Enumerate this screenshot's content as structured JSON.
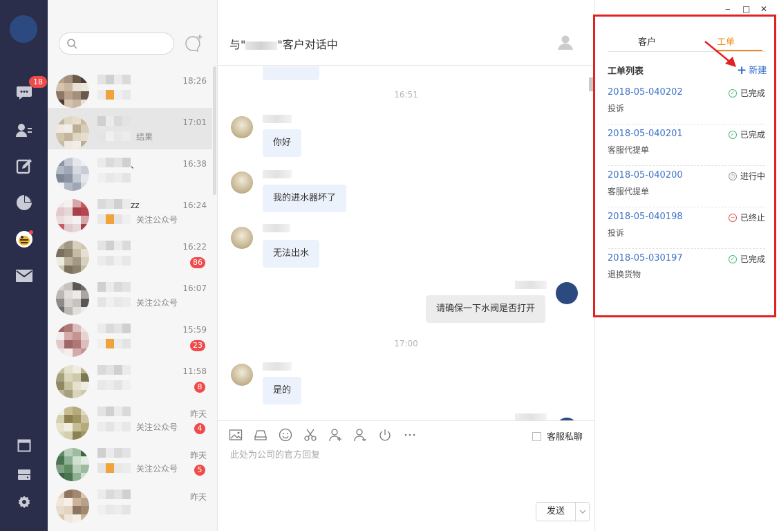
{
  "nav": {
    "chat_badge": "18"
  },
  "search": {
    "placeholder": ""
  },
  "conversations": [
    {
      "time": "18:26",
      "name_text": "",
      "preview_text": "",
      "count": ""
    },
    {
      "time": "17:01",
      "name_text": "",
      "preview_text": "结果",
      "count": ""
    },
    {
      "time": "16:38",
      "name_text": "、",
      "preview_text": "",
      "count": ""
    },
    {
      "time": "16:24",
      "name_text": "zz",
      "preview_text": "关注公众号",
      "count": ""
    },
    {
      "time": "16:22",
      "name_text": "",
      "preview_text": "",
      "count": "86"
    },
    {
      "time": "16:07",
      "name_text": "",
      "preview_text": "关注公众号",
      "count": ""
    },
    {
      "time": "15:59",
      "name_text": "",
      "preview_text": "",
      "count": "23"
    },
    {
      "time": "11:58",
      "name_text": "",
      "preview_text": "",
      "count": "8"
    },
    {
      "time": "昨天",
      "name_text": "",
      "preview_text": "关注公众号",
      "count": "4"
    },
    {
      "time": "昨天",
      "name_text": "",
      "preview_text": "关注公众号",
      "count": "5"
    },
    {
      "time": "昨天",
      "name_text": "",
      "preview_text": "",
      "count": ""
    }
  ],
  "chat": {
    "title_prefix": "与\"",
    "title_suffix": "\"客户对话中",
    "timestamps": [
      "16:51",
      "17:00"
    ],
    "messages": [
      {
        "text": "你好"
      },
      {
        "text": "我的进水器坏了"
      },
      {
        "text": "无法出水"
      },
      {
        "text": "请确保一下水阀是否打开"
      },
      {
        "text": "是的"
      }
    ],
    "private_label": "客服私聊",
    "input_placeholder": "此处为公司的官方回复",
    "send_label": "发送"
  },
  "window": {
    "minimize": "‒",
    "maximize": "□",
    "close": "✕"
  },
  "panel": {
    "tabs": [
      "客户",
      "工单"
    ],
    "active_tab": "工单",
    "list_title": "工单列表",
    "new_label": "新建",
    "work_orders": [
      {
        "id": "2018-05-040202",
        "type": "投诉",
        "status": "已完成",
        "status_kind": "done"
      },
      {
        "id": "2018-05-040201",
        "type": "客服代提单",
        "status": "已完成",
        "status_kind": "done"
      },
      {
        "id": "2018-05-040200",
        "type": "客服代提单",
        "status": "进行中",
        "status_kind": "progress"
      },
      {
        "id": "2018-05-040198",
        "type": "投诉",
        "status": "已终止",
        "status_kind": "stopped"
      },
      {
        "id": "2018-05-030197",
        "type": "退换货物",
        "status": "已完成",
        "status_kind": "done"
      }
    ]
  },
  "colors": {
    "accent": "#f08a16",
    "link": "#3d72c7",
    "highlight": "#e02222",
    "nav_bg": "#2b2e4a"
  }
}
